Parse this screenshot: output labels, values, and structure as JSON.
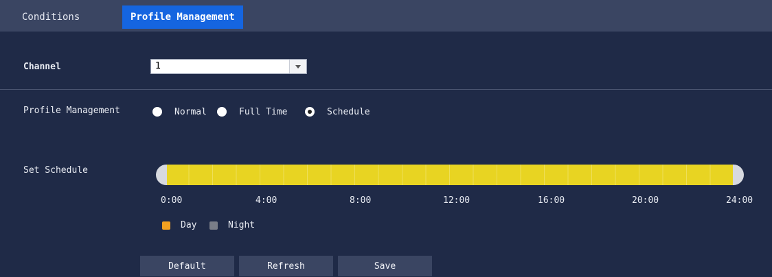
{
  "tabs": [
    {
      "label": "Conditions"
    },
    {
      "label": "Profile Management"
    }
  ],
  "channel": {
    "label": "Channel",
    "value": "1"
  },
  "profile": {
    "label": "Profile Management",
    "options": [
      {
        "label": "Normal",
        "checked": false
      },
      {
        "label": "Full Time",
        "checked": false
      },
      {
        "label": "Schedule",
        "checked": true
      }
    ]
  },
  "schedule": {
    "label": "Set Schedule",
    "bar_color": "#e8d422",
    "day_range": [
      0,
      24
    ],
    "ticks": [
      "0:00",
      "4:00",
      "8:00",
      "12:00",
      "16:00",
      "20:00",
      "24:00"
    ]
  },
  "legend": {
    "day": {
      "label": "Day",
      "color": "#f2a020"
    },
    "night": {
      "label": "Night",
      "color": "#7a7e88"
    }
  },
  "buttons": {
    "default": "Default",
    "refresh": "Refresh",
    "save": "Save"
  }
}
